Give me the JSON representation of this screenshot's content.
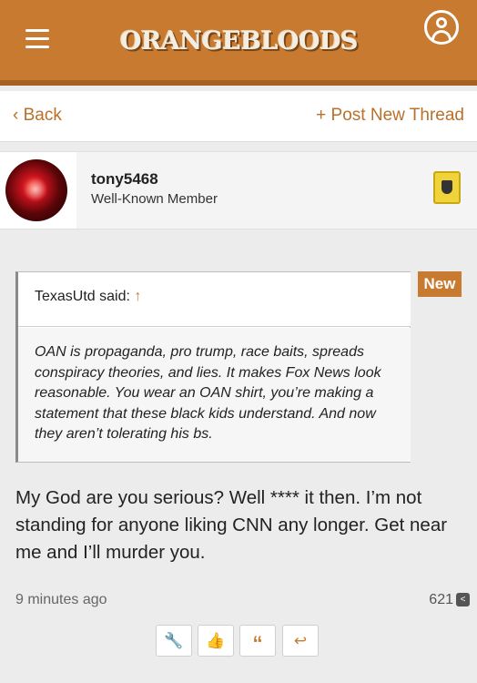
{
  "header": {
    "logo": "ORANGEBLOODS",
    "menu_icon": "hamburger-menu-icon",
    "account_icon": "user-circle-icon"
  },
  "nav": {
    "back_label": "Back",
    "post_new_label": "Post New Thread"
  },
  "member": {
    "username": "tony5468",
    "title": "Well-Known Member",
    "badge_icon": "shield-badge-icon"
  },
  "quote": {
    "author_line": "TexasUtd said: ",
    "arrow": "↑",
    "text": "OAN is propaganda, pro trump, race baits, spreads conspiracy theories, and lies. It makes Fox News look reasonable. You wear an OAN shirt, you’re making a statement that these black kids understand. And now they aren’t tolerating his bs."
  },
  "new_label": "New",
  "message": {
    "text": "My God are you serious? Well **** it then. I’m not standing for anyone liking CNN any longer. Get near me and I’ll murder you.",
    "timestamp": "9 minutes ago",
    "post_number": "621"
  },
  "actions": [
    {
      "icon": "wrench-icon"
    },
    {
      "icon": "thumbs-up-icon"
    },
    {
      "icon": "quote-icon"
    },
    {
      "icon": "reply-icon"
    }
  ],
  "colors": {
    "brand": "#c77a30",
    "brand_dark": "#a55f1f",
    "link": "#b9702b"
  }
}
